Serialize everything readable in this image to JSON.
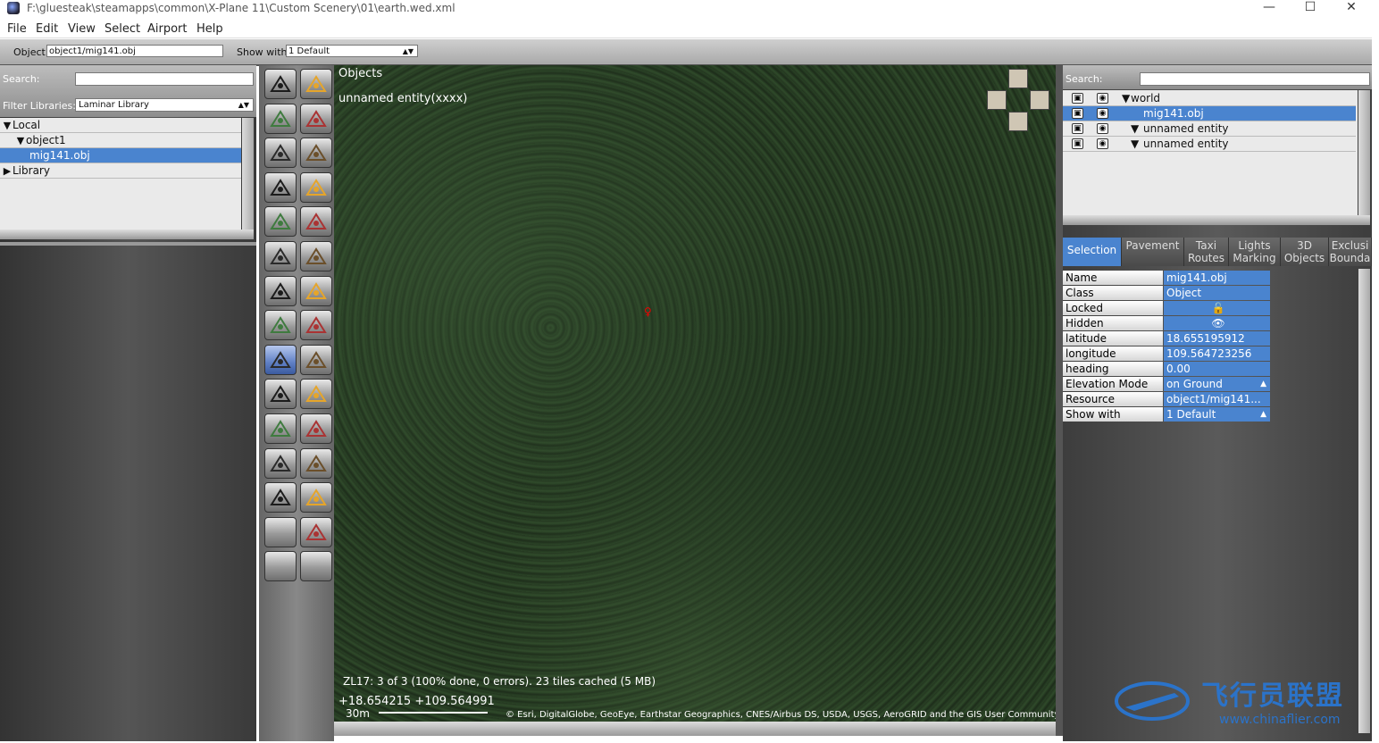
{
  "window": {
    "title": "F:\\gluesteak\\steamapps\\common\\X-Plane 11\\Custom Scenery\\01\\earth.wed.xml",
    "minimize": "—",
    "maximize": "☐",
    "close": "✕"
  },
  "menu": [
    "File",
    "Edit",
    "View",
    "Select",
    "Airport",
    "Help"
  ],
  "toolbar": {
    "object_label": "Object",
    "object_value": "object1/mig141.obj",
    "show_with_label": "Show with",
    "show_with_value": "1 Default"
  },
  "library": {
    "search_label": "Search:",
    "filter_label": "Filter Libraries:",
    "filter_value": "Laminar Library",
    "tree": [
      {
        "label": "Local",
        "expander": "▼",
        "indent": 0,
        "selected": false
      },
      {
        "label": "object1",
        "expander": "▼",
        "indent": 1,
        "selected": false
      },
      {
        "label": "mig141.obj",
        "expander": "",
        "indent": 2,
        "selected": true
      },
      {
        "label": "Library",
        "expander": "▶",
        "indent": 0,
        "selected": false
      }
    ]
  },
  "tools": [
    "marquee-arrow",
    "rect-select",
    "runway",
    "helipad",
    "taxiway",
    "sealane",
    "taxi-route",
    "boundary",
    "light",
    "sign",
    "object",
    "windsock",
    "tower-viewpoint",
    "ramp-start",
    "facade",
    "atc",
    "forest-active",
    "facade-block",
    "tree",
    "line",
    "polygon",
    "draped-poly",
    "exclusion",
    "road",
    "truck-parking",
    "truck-destination",
    "blank-1",
    "autogen",
    "blank-2",
    "blank-3"
  ],
  "map": {
    "layer_title": "Objects",
    "entity_label": "unnamed entity(xxxx)",
    "status": "ZL17: 3 of 3 (100% done, 0 errors). 23 tiles cached (5 MB)",
    "coords": "+18.654215 +109.564991",
    "scale": "30m",
    "attribution": "© Esri, DigitalGlobe, GeoEye, Earthstar Geographics, CNES/Airbus DS, USDA, USGS, AeroGRID and the GIS User Community"
  },
  "hierarchy": {
    "search_label": "Search:",
    "rows": [
      {
        "label": "world",
        "expander": "▼",
        "indent": 0,
        "selected": false
      },
      {
        "label": "mig141.obj",
        "expander": "",
        "indent": 1,
        "selected": true
      },
      {
        "label": "unnamed entity",
        "expander": "▼",
        "indent": 1,
        "selected": false
      },
      {
        "label": "unnamed entity",
        "expander": "▼",
        "indent": 1,
        "selected": false
      }
    ]
  },
  "tabs": [
    {
      "line1": "Selection",
      "line2": "",
      "selected": true
    },
    {
      "line1": "Pavement",
      "line2": "",
      "selected": false
    },
    {
      "line1": "Taxi",
      "line2": "Routes",
      "selected": false
    },
    {
      "line1": "Lights",
      "line2": "Marking",
      "selected": false
    },
    {
      "line1": "3D",
      "line2": "Objects",
      "selected": false
    },
    {
      "line1": "Exclusi",
      "line2": "Bounda",
      "selected": false
    }
  ],
  "properties": [
    {
      "key": "Name",
      "value": "mig141.obj",
      "dropdown": false
    },
    {
      "key": "Class",
      "value": "Object",
      "dropdown": false
    },
    {
      "key": "Locked",
      "value": "🔓",
      "dropdown": false
    },
    {
      "key": "Hidden",
      "value": "👁",
      "dropdown": false
    },
    {
      "key": "latitude",
      "value": " 18.655195912",
      "dropdown": false
    },
    {
      "key": "longitude",
      "value": " 109.564723256",
      "dropdown": false
    },
    {
      "key": "heading",
      "value": "  0.00",
      "dropdown": false
    },
    {
      "key": "Elevation Mode",
      "value": "on Ground",
      "dropdown": true
    },
    {
      "key": "Resource",
      "value": "object1/mig141...",
      "dropdown": false
    },
    {
      "key": "Show with",
      "value": "1 Default",
      "dropdown": true
    }
  ],
  "watermark": {
    "cn": "飞行员联盟",
    "url": "www.chinaflier.com"
  },
  "colors": {
    "selection": "#4a84cf",
    "map_bg": "#263a23"
  }
}
